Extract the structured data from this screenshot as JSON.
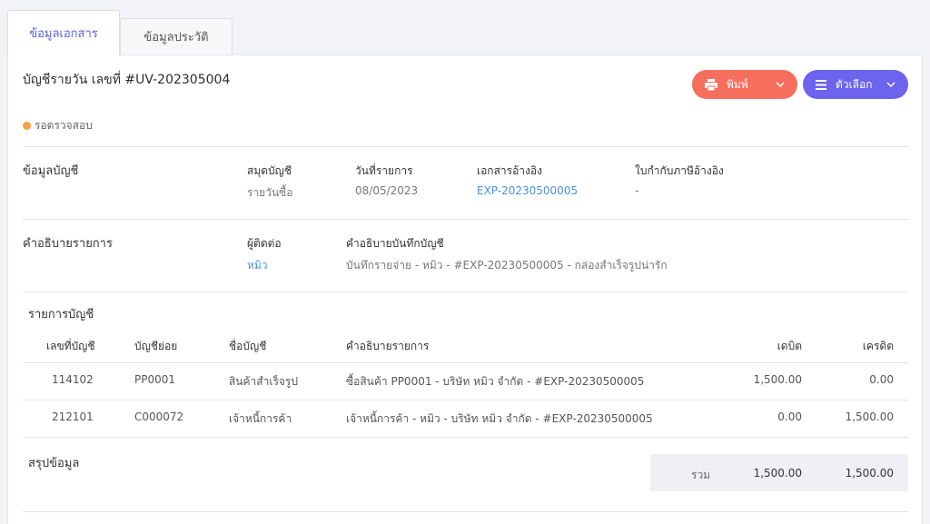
{
  "tabs": [
    {
      "label": "ข้อมูลเอกสาร",
      "active": true
    },
    {
      "label": "ข้อมูลประวัติ",
      "active": false
    }
  ],
  "header": {
    "title": "บัญชีรายวัน เลขที่ #UV-202305004",
    "print_label": "พิมพ์",
    "options_label": "ตัวเลือก"
  },
  "status": {
    "label": "รอตรวจสอบ",
    "color": "#f4a340"
  },
  "account_info": {
    "section_title": "ข้อมูลบัญชี",
    "book_label": "สมุดบัญชี",
    "book_value": "รายวันซื้อ",
    "date_label": "วันที่รายการ",
    "date_value": "08/05/2023",
    "ref_label": "เอกสารอ้างอิง",
    "ref_value": "EXP-20230500005",
    "tax_label": "ใบกำกับภาษีอ้างอิง",
    "tax_value": "-"
  },
  "description": {
    "section_title": "คำอธิบายรายการ",
    "contact_label": "ผู้ติดต่อ",
    "contact_value": "หมิว",
    "note_label": "คำอธิบายบันทึกบัญชี",
    "note_value": "บันทึกรายจ่าย - หมิว - #EXP-20230500005 - กล่องสำเร็จรูปน่ารัก"
  },
  "entries": {
    "section_title": "รายการบัญชี",
    "columns": [
      "เลขที่บัญชี",
      "บัญชีย่อย",
      "ชื่อบัญชี",
      "คำอธิบายรายการ",
      "เดบิต",
      "เครดิต"
    ],
    "rows": [
      [
        "114102",
        "PP0001",
        "สินค้าสำเร็จรูป",
        "ซื้อสินค้า PP0001 - บริษัท หมิว จำกัด - #EXP-20230500005",
        "1,500.00",
        "0.00"
      ],
      [
        "212101",
        "C000072",
        "เจ้าหนี้การค้า",
        "เจ้าหนี้การค้า - หมิว - บริษัท หมิว จำกัด - #EXP-20230500005",
        "0.00",
        "1,500.00"
      ]
    ]
  },
  "summary": {
    "section_title": "สรุปข้อมูล",
    "total_label": "รวม",
    "total_debit": "1,500.00",
    "total_credit": "1,500.00"
  },
  "colors": {
    "accent": "#6c63ee",
    "print": "#f56f5c",
    "link": "#4a90e2"
  }
}
